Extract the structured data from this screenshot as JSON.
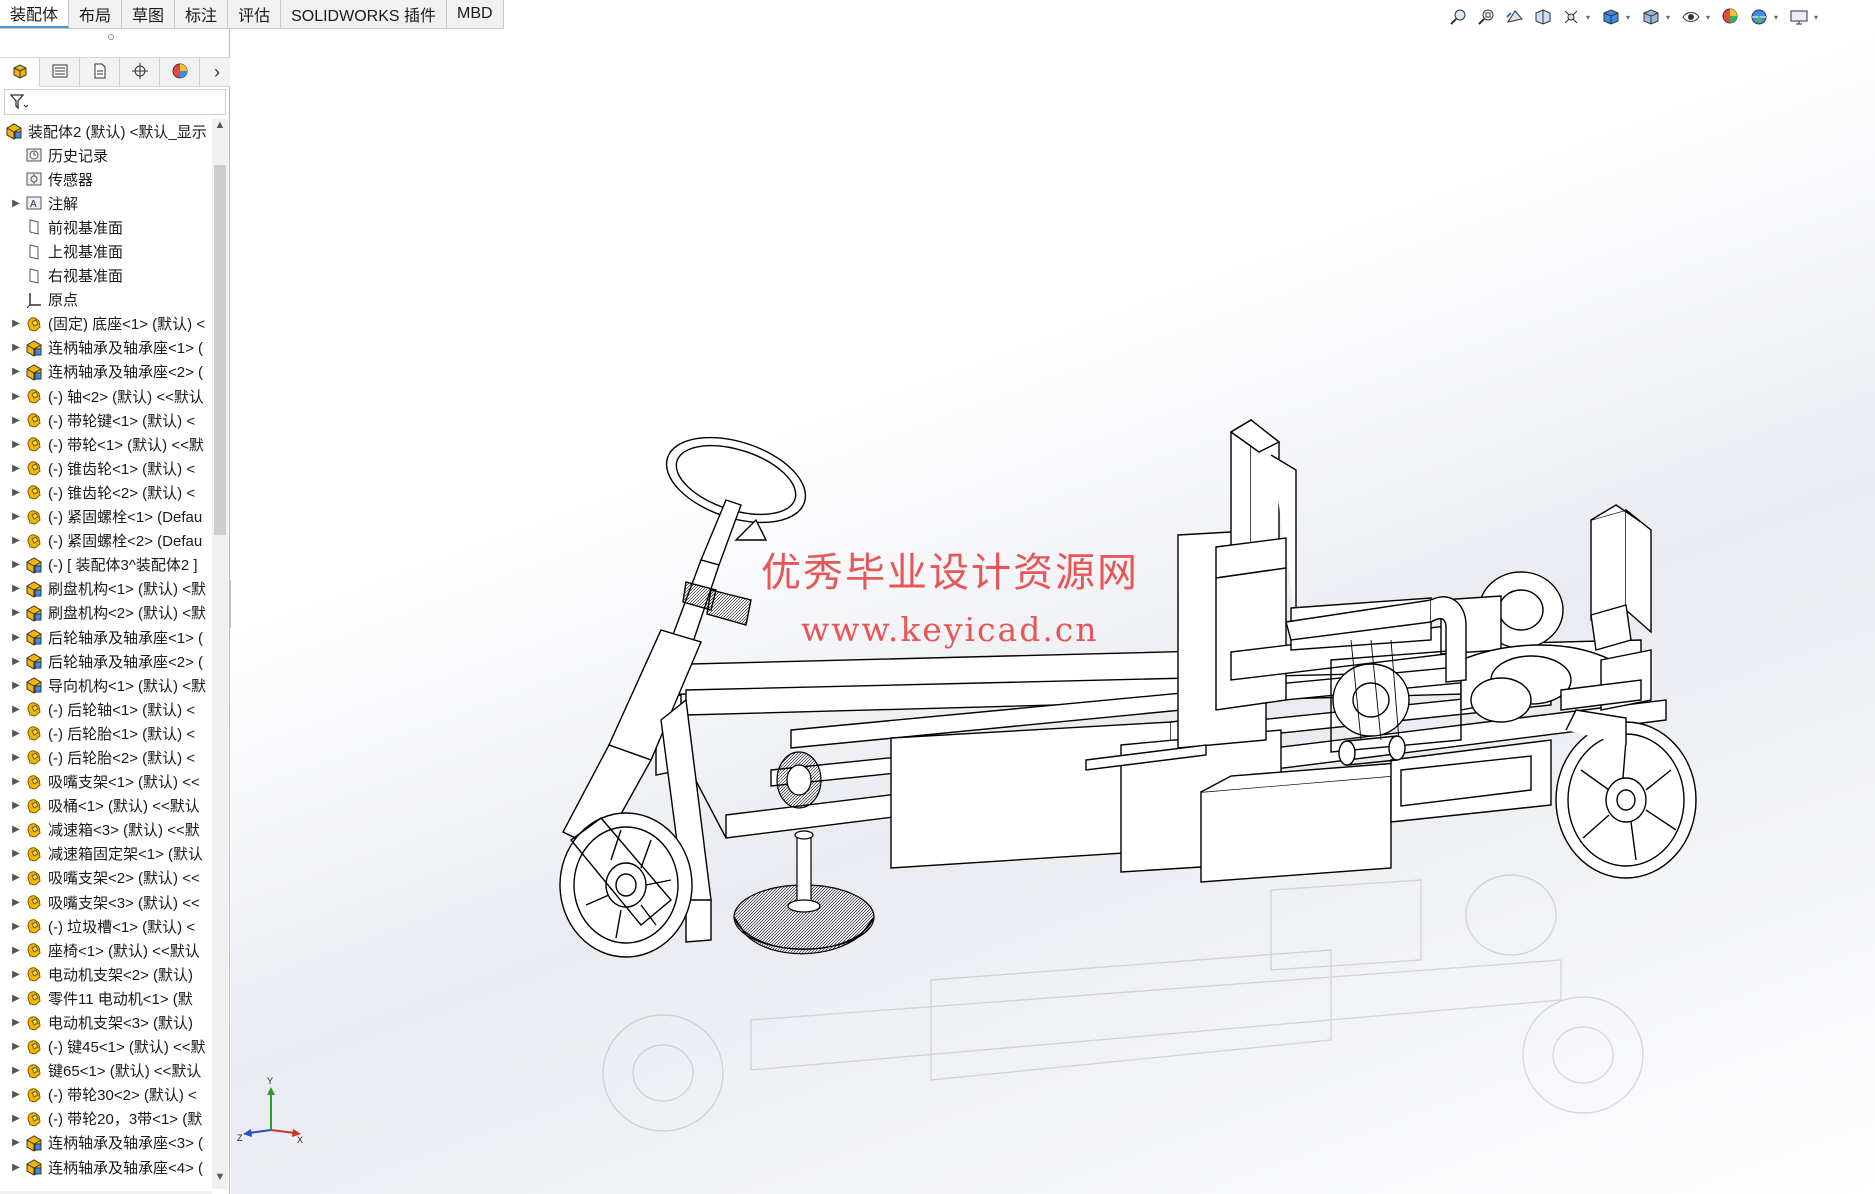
{
  "tabs": [
    {
      "label": "装配体",
      "active": true
    },
    {
      "label": "布局",
      "active": false
    },
    {
      "label": "草图",
      "active": false
    },
    {
      "label": "标注",
      "active": false
    },
    {
      "label": "评估",
      "active": false
    },
    {
      "label": "SOLIDWORKS 插件",
      "active": false
    },
    {
      "label": "MBD",
      "active": false
    }
  ],
  "panel_tabs": [
    "feature-manager-icon",
    "property-manager-icon",
    "configuration-manager-icon",
    "dimxpert-icon",
    "display-manager-icon"
  ],
  "tree": {
    "root": "装配体2 (默认) <默认_显示",
    "items": [
      {
        "label": "历史记录",
        "icon": "history-icon",
        "expand": false
      },
      {
        "label": "传感器",
        "icon": "sensor-icon",
        "expand": false
      },
      {
        "label": "注解",
        "icon": "annotation-icon",
        "expand": true
      },
      {
        "label": "前视基准面",
        "icon": "plane-icon",
        "expand": false
      },
      {
        "label": "上视基准面",
        "icon": "plane-icon",
        "expand": false
      },
      {
        "label": "右视基准面",
        "icon": "plane-icon",
        "expand": false
      },
      {
        "label": "原点",
        "icon": "origin-icon",
        "expand": false
      },
      {
        "label": "(固定) 底座<1> (默认) <",
        "icon": "part-icon",
        "expand": true
      },
      {
        "label": "连柄轴承及轴承座<1> (",
        "icon": "subassembly-icon",
        "expand": true
      },
      {
        "label": "连柄轴承及轴承座<2> (",
        "icon": "subassembly-icon",
        "expand": true
      },
      {
        "label": "(-) 轴<2> (默认) <<默认",
        "icon": "part-icon",
        "expand": true
      },
      {
        "label": "(-) 带轮键<1> (默认) <",
        "icon": "part-icon",
        "expand": true
      },
      {
        "label": "(-) 带轮<1> (默认) <<默",
        "icon": "part-icon",
        "expand": true
      },
      {
        "label": "(-) 锥齿轮<1> (默认) <",
        "icon": "part-icon",
        "expand": true
      },
      {
        "label": "(-) 锥齿轮<2> (默认) <",
        "icon": "part-icon",
        "expand": true
      },
      {
        "label": "(-) 紧固螺栓<1> (Defau",
        "icon": "part-icon",
        "expand": true
      },
      {
        "label": "(-) 紧固螺栓<2> (Defau",
        "icon": "part-icon",
        "expand": true
      },
      {
        "label": "(-) [ 装配体3^装配体2 ]",
        "icon": "subassembly-icon",
        "expand": true
      },
      {
        "label": "刷盘机构<1> (默认) <默",
        "icon": "subassembly-icon",
        "expand": true
      },
      {
        "label": "刷盘机构<2> (默认) <默",
        "icon": "subassembly-icon",
        "expand": true
      },
      {
        "label": "后轮轴承及轴承座<1> (",
        "icon": "subassembly-icon",
        "expand": true
      },
      {
        "label": "后轮轴承及轴承座<2> (",
        "icon": "subassembly-icon",
        "expand": true
      },
      {
        "label": "导向机构<1> (默认) <默",
        "icon": "subassembly-icon",
        "expand": true
      },
      {
        "label": "(-) 后轮轴<1> (默认) <",
        "icon": "part-icon",
        "expand": true
      },
      {
        "label": "(-) 后轮胎<1> (默认) <",
        "icon": "part-icon",
        "expand": true
      },
      {
        "label": "(-) 后轮胎<2> (默认) <",
        "icon": "part-icon",
        "expand": true
      },
      {
        "label": "吸嘴支架<1> (默认) <<",
        "icon": "part-icon",
        "expand": true
      },
      {
        "label": "吸桶<1> (默认) <<默认",
        "icon": "part-icon",
        "expand": true
      },
      {
        "label": "减速箱<3> (默认) <<默",
        "icon": "part-icon",
        "expand": true
      },
      {
        "label": "减速箱固定架<1> (默认",
        "icon": "part-icon",
        "expand": true
      },
      {
        "label": "吸嘴支架<2> (默认) <<",
        "icon": "part-icon",
        "expand": true
      },
      {
        "label": "吸嘴支架<3> (默认) <<",
        "icon": "part-icon",
        "expand": true
      },
      {
        "label": "(-) 垃圾槽<1> (默认) <",
        "icon": "part-icon",
        "expand": true
      },
      {
        "label": "座椅<1> (默认) <<默认",
        "icon": "part-icon",
        "expand": true
      },
      {
        "label": "电动机支架<2> (默认) ",
        "icon": "part-icon",
        "expand": true
      },
      {
        "label": "零件11 电动机<1> (默",
        "icon": "part-icon",
        "expand": true
      },
      {
        "label": "电动机支架<3> (默认) ",
        "icon": "part-icon",
        "expand": true
      },
      {
        "label": "(-) 键45<1> (默认) <<默",
        "icon": "part-icon",
        "expand": true
      },
      {
        "label": "键65<1> (默认) <<默认",
        "icon": "part-icon",
        "expand": true
      },
      {
        "label": "(-) 带轮30<2> (默认) <",
        "icon": "part-icon",
        "expand": true
      },
      {
        "label": "(-) 带轮20，3带<1> (默",
        "icon": "part-icon",
        "expand": true
      },
      {
        "label": "连柄轴承及轴承座<3> (",
        "icon": "subassembly-icon",
        "expand": true
      },
      {
        "label": "连柄轴承及轴承座<4> (",
        "icon": "subassembly-icon",
        "expand": true
      }
    ]
  },
  "hud_icons": [
    "zoom-to-fit-icon",
    "zoom-area-icon",
    "previous-view-icon",
    "section-view-icon",
    "dynamic-annotation-icon",
    "view-orientation-icon",
    "display-style-icon",
    "hide-show-icon",
    "edit-appearance-icon",
    "apply-scene-icon",
    "view-settings-icon"
  ],
  "watermark": {
    "title": "优秀毕业设计资源网",
    "url": "www.keyicad.cn"
  },
  "triad": {
    "x": "X",
    "y": "Y",
    "z": "Z"
  },
  "colors": {
    "accent": "#4a90d9",
    "watermark": "#e63a3a",
    "part_icon": "#f2b600"
  }
}
